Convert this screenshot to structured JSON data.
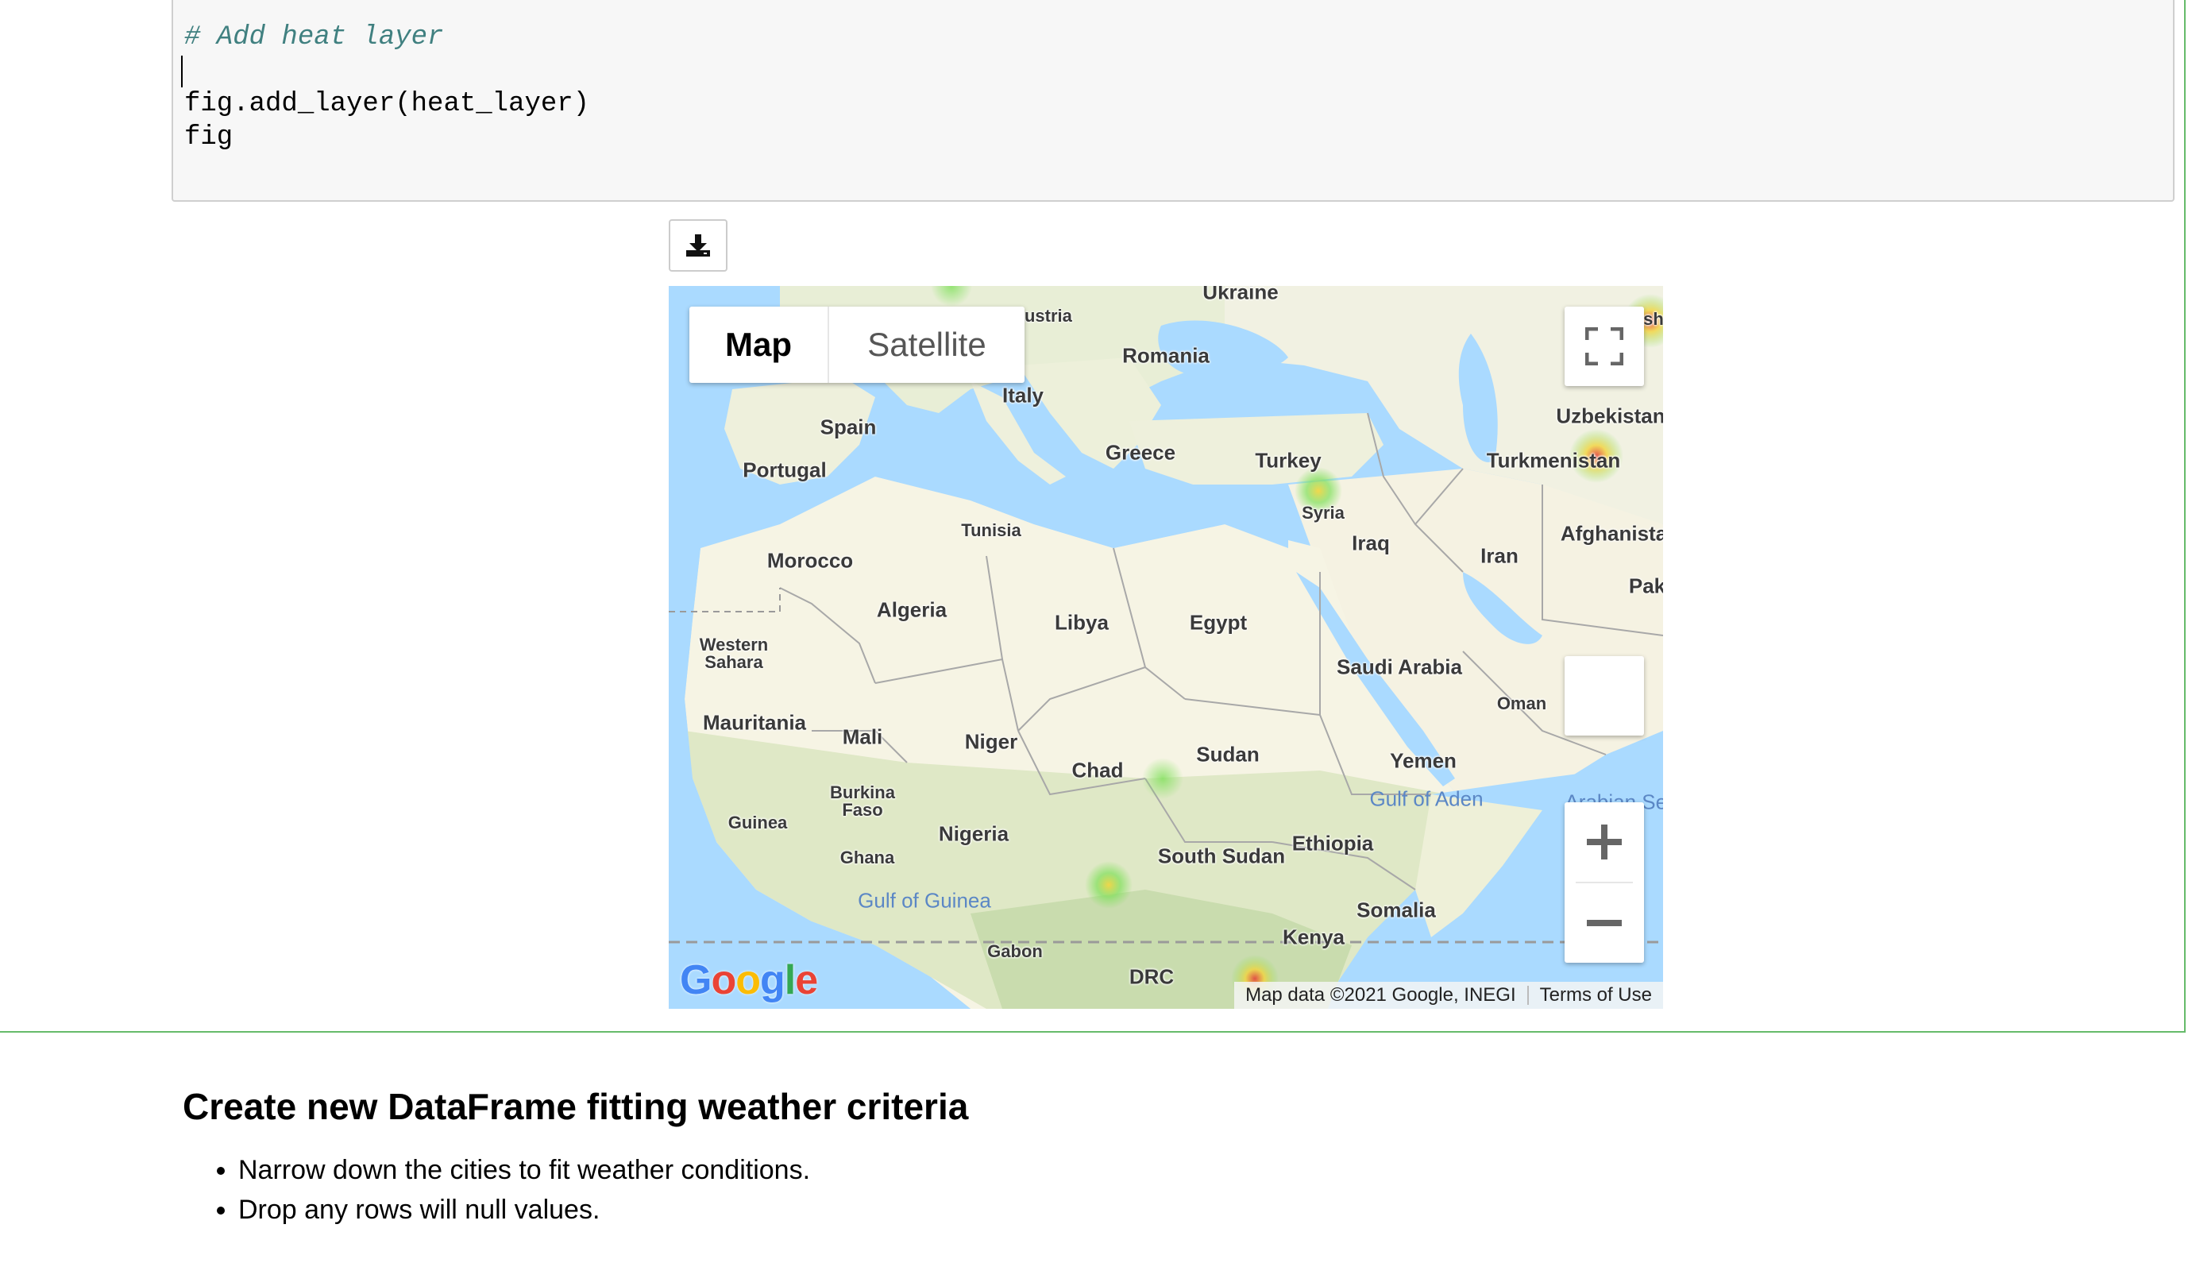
{
  "code": {
    "lines": [
      "# Add heat layer",
      "",
      "fig.add_layer(heat_layer)",
      "fig"
    ]
  },
  "download_button": {
    "icon": "download-icon"
  },
  "map": {
    "map_type": {
      "map_label": "Map",
      "satellite_label": "Satellite",
      "selected": "Map"
    },
    "labels": {
      "ukraine": "Ukraine",
      "austria": "Austria",
      "romania": "Romania",
      "italy": "Italy",
      "spain": "Spain",
      "portugal": "Portugal",
      "greece": "Greece",
      "turkey": "Turkey",
      "uzbekistan": "Uzbekistan",
      "turkmenistan": "Turkmenistan",
      "syria": "Syria",
      "iraq": "Iraq",
      "iran": "Iran",
      "afghanistan": "Afghanista",
      "pak": "Pak",
      "tunisia": "Tunisia",
      "morocco": "Morocco",
      "algeria": "Algeria",
      "libya": "Libya",
      "egypt": "Egypt",
      "western_sahara_1": "Western",
      "western_sahara_2": "Sahara",
      "saudi_arabia": "Saudi Arabia",
      "oman": "Oman",
      "mauritania": "Mauritania",
      "mali": "Mali",
      "niger": "Niger",
      "chad": "Chad",
      "sudan": "Sudan",
      "yemen": "Yemen",
      "gulf_of_aden": "Gulf of Aden",
      "arabian_sea": "Arabian Sea",
      "burkina_1": "Burkina",
      "burkina_2": "Faso",
      "guinea": "Guinea",
      "nigeria": "Nigeria",
      "ghana": "Ghana",
      "south_sudan": "South Sudan",
      "ethiopia": "Ethiopia",
      "gulf_of_guinea": "Gulf of Guinea",
      "somalia": "Somalia",
      "kenya": "Kenya",
      "gabon": "Gabon",
      "drc": "DRC",
      "kazakh_partial": "sh"
    },
    "attribution": {
      "data": "Map data ©2021 Google, INEGI",
      "terms": "Terms of Use"
    },
    "logo": "Google",
    "controls": {
      "fullscreen_icon": "fullscreen-icon",
      "zoom_in_icon": "plus-icon",
      "zoom_out_icon": "minus-icon",
      "pegman": "blank-control"
    },
    "heat_colors": {
      "low": "#7fe05a",
      "mid": "#f2d43c",
      "high": "#e3423a"
    }
  },
  "markdown": {
    "heading": "Create new DataFrame fitting weather criteria",
    "bullets": [
      "Narrow down the cities to fit weather conditions.",
      "Drop any rows will null values."
    ]
  }
}
